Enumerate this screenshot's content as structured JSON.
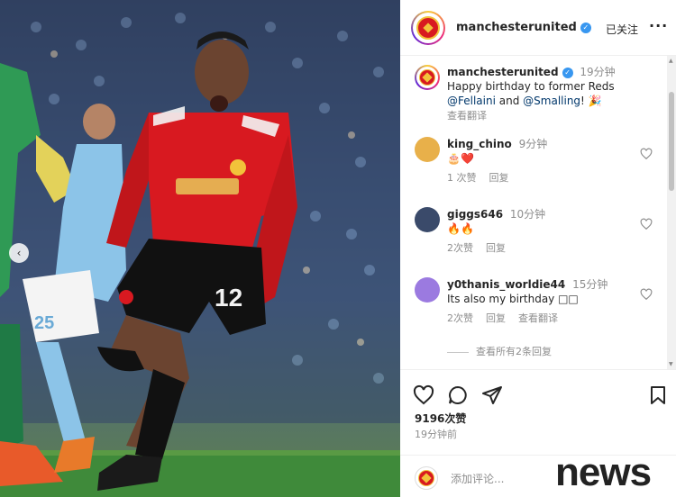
{
  "post": {
    "username": "manchesterunited",
    "follow_status": "已关注",
    "more": "···",
    "caption": {
      "username": "manchesterunited",
      "time_ago": "19分钟",
      "text_line1": "Happy birthday to former Reds",
      "mention1": "@Fellaini",
      "and_text": " and ",
      "mention2": "@Smalling",
      "tail": "! 🎉",
      "translate": "查看翻译"
    },
    "comments": [
      {
        "username": "king_chino",
        "time_ago": "9分钟",
        "text": "🎂❤️",
        "likes": "1 次赞",
        "reply": "回复",
        "avatar_color": "#e8b04a"
      },
      {
        "username": "giggs646",
        "time_ago": "10分钟",
        "text": "🔥🔥",
        "likes": "2次赞",
        "reply": "回复",
        "avatar_color": "#3a4a6a"
      },
      {
        "username": "y0thanis_worldie44",
        "time_ago": "15分钟",
        "text": "Its also my birthday □□",
        "likes": "2次赞",
        "reply": "回复",
        "translate": "查看翻译",
        "avatar_color": "#9b7ae0"
      }
    ],
    "view_replies": "查看所有2条回复",
    "likes_count": "9196次赞",
    "post_time": "19分钟前",
    "add_comment_placeholder": "添加评论...",
    "icons": {
      "like": "heart-icon",
      "comment": "comment-icon",
      "share": "share-icon",
      "save": "bookmark-icon",
      "prev": "chevron-left-icon"
    }
  },
  "photo": {
    "shirt_number": "12",
    "away_number": "25"
  },
  "watermark": "news",
  "colors": {
    "united_red": "#d81920",
    "city_blue": "#8cc4e8",
    "pitch_green": "#3f8a3a",
    "link": "#00376b",
    "muted": "#8e8e8e"
  }
}
